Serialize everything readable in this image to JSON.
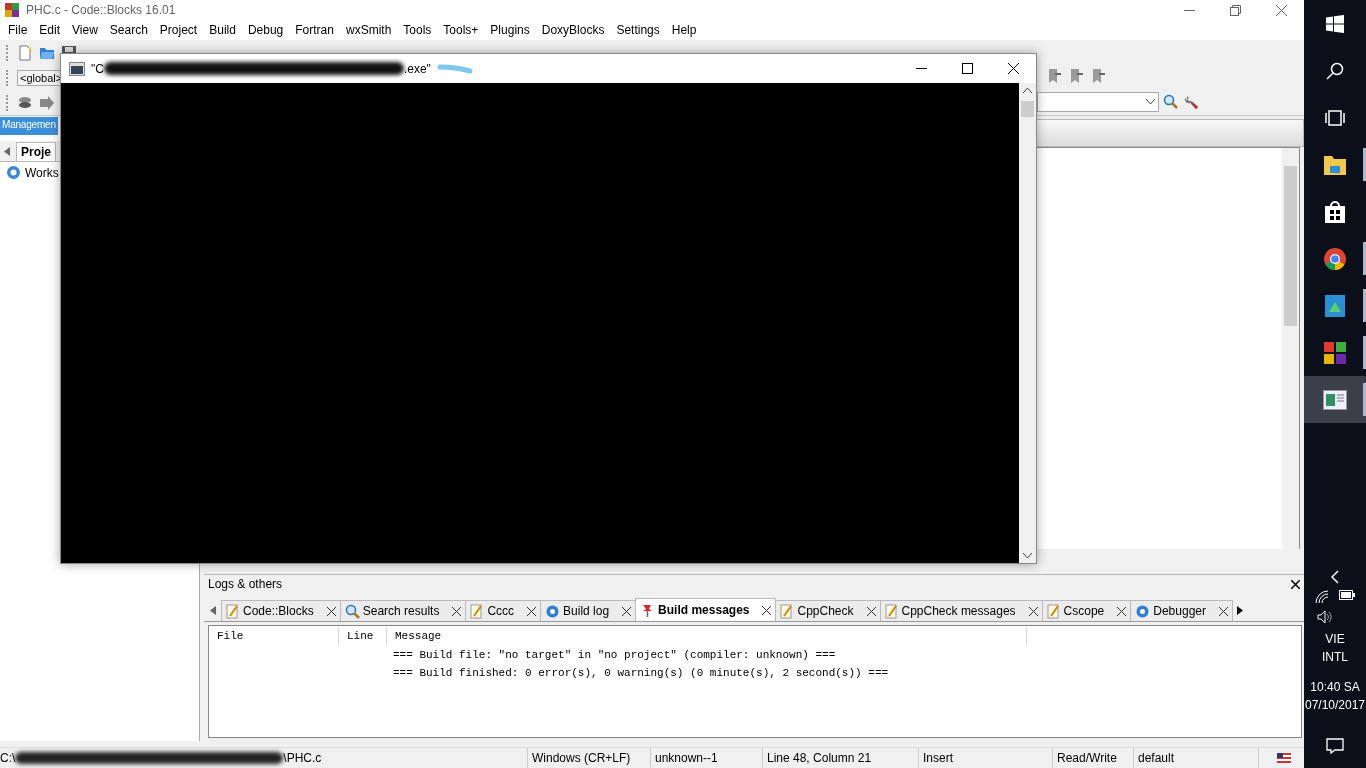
{
  "window": {
    "title": "PHC.c - Code::Blocks 16.01"
  },
  "menu": [
    "File",
    "Edit",
    "View",
    "Search",
    "Project",
    "Build",
    "Debug",
    "Fortran",
    "wxSmith",
    "Tools",
    "Tools+",
    "Plugins",
    "DoxyBlocks",
    "Settings",
    "Help"
  ],
  "toolbar": {
    "scope": "<global>"
  },
  "management": {
    "title": "Managemen",
    "tab": "Proje",
    "tree_item": "Works"
  },
  "console_window": {
    "title_start": "\"C",
    "title_end": ".exe\""
  },
  "logs": {
    "title": "Logs & others",
    "tabs": [
      {
        "label": "Code::Blocks",
        "kind": "note",
        "selected": false
      },
      {
        "label": "Search results",
        "kind": "search",
        "selected": false
      },
      {
        "label": "Cccc",
        "kind": "note",
        "selected": false
      },
      {
        "label": "Build log",
        "kind": "gear",
        "selected": false
      },
      {
        "label": "Build messages",
        "kind": "pin",
        "selected": true
      },
      {
        "label": "CppCheck",
        "kind": "note",
        "selected": false
      },
      {
        "label": "CppCheck messages",
        "kind": "note",
        "selected": false
      },
      {
        "label": "Cscope",
        "kind": "note",
        "selected": false
      },
      {
        "label": "Debugger",
        "kind": "gear",
        "selected": false
      }
    ],
    "columns": [
      "File",
      "Line",
      "Message"
    ],
    "rows": [
      {
        "message": "=== Build file: \"no target\" in \"no project\" (compiler: unknown) ==="
      },
      {
        "message": "=== Build finished: 0 error(s), 0 warning(s) (0 minute(s), 2 second(s)) ==="
      }
    ]
  },
  "status_bar": {
    "path_start": "C:\\",
    "path_end": "\\PHC.c",
    "items": [
      "Windows (CR+LF)",
      "unknown--1",
      "Line 48, Column 21",
      "Insert",
      "Read/Write",
      "default"
    ]
  },
  "taskbar": {
    "apps": [
      {
        "kind": "explorer",
        "running": true,
        "selected": false
      },
      {
        "kind": "store",
        "running": false,
        "selected": false
      },
      {
        "kind": "chrome",
        "running": true,
        "selected": false
      },
      {
        "kind": "photos",
        "running": true,
        "selected": false
      },
      {
        "kind": "tiles",
        "running": true,
        "selected": false
      },
      {
        "kind": "window",
        "running": true,
        "selected": true
      }
    ],
    "language": [
      "VIE",
      "INTL"
    ],
    "time": "10:40 SA",
    "date": "07/10/2017"
  }
}
